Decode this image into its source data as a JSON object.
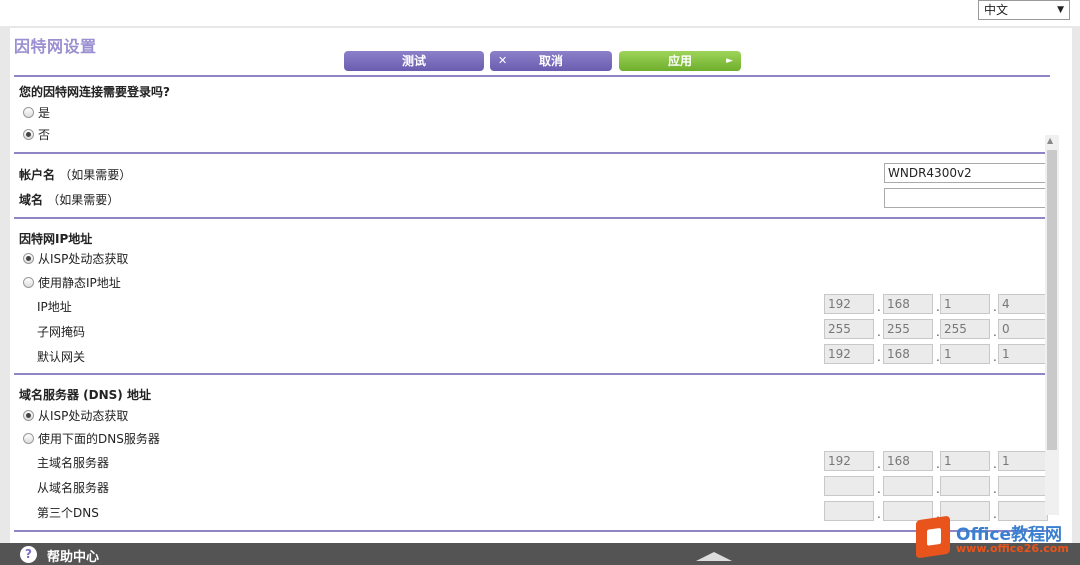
{
  "language": {
    "selected": "中文"
  },
  "page": {
    "title": "因特网设置"
  },
  "buttons": {
    "test": "测试",
    "cancel": "取消",
    "apply": "应用"
  },
  "login": {
    "question": "您的因特网连接需要登录吗?",
    "options": [
      {
        "label": "是",
        "checked": false
      },
      {
        "label": "否",
        "checked": true
      }
    ]
  },
  "account": {
    "username_label": "帐户名",
    "username_hint": "（如果需要）",
    "username_value": "WNDR4300v2",
    "domain_label": "域名",
    "domain_hint": "（如果需要）",
    "domain_value": ""
  },
  "ip": {
    "title": "因特网IP地址",
    "options": [
      {
        "label": "从ISP处动态获取",
        "checked": true
      },
      {
        "label": "使用静态IP地址",
        "checked": false
      }
    ],
    "fields": [
      {
        "label": "IP地址",
        "octets": [
          "192",
          "168",
          "1",
          "4"
        ]
      },
      {
        "label": "子网掩码",
        "octets": [
          "255",
          "255",
          "255",
          "0"
        ]
      },
      {
        "label": "默认网关",
        "octets": [
          "192",
          "168",
          "1",
          "1"
        ]
      }
    ]
  },
  "dns": {
    "title": "域名服务器 (DNS) 地址",
    "options": [
      {
        "label": "从ISP处动态获取",
        "checked": true
      },
      {
        "label": "使用下面的DNS服务器",
        "checked": false
      }
    ],
    "fields": [
      {
        "label": "主域名服务器",
        "octets": [
          "192",
          "168",
          "1",
          "1"
        ]
      },
      {
        "label": "从域名服务器",
        "octets": [
          "",
          "",
          "",
          ""
        ]
      },
      {
        "label": "第三个DNS",
        "octets": [
          "",
          "",
          "",
          ""
        ]
      }
    ]
  },
  "footer": {
    "help": "帮助中心"
  },
  "watermark": {
    "title": "Office教程网",
    "url": "www.office26.com"
  },
  "icons": {
    "cancel": "close-icon",
    "apply": "arrow-right-icon",
    "help": "question-icon",
    "footer": "expand-up-icon"
  }
}
